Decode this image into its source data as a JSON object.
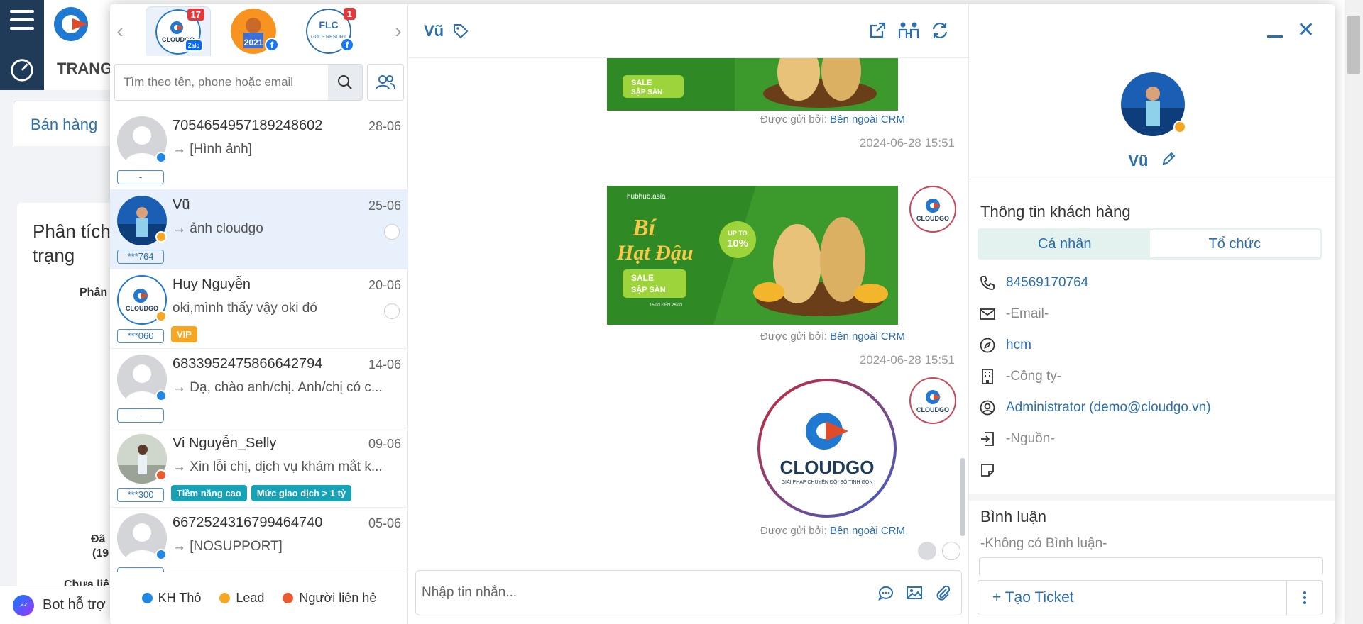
{
  "background": {
    "app_header": "TRANG",
    "tab_label": "Bán hàng",
    "card_title": "Phân tích trạng",
    "card_texts": [
      "Phân",
      "Đã",
      "(19",
      "Chưa liê"
    ],
    "bot_label": "Bot hỗ trợ"
  },
  "pages": [
    {
      "name": "CloudGO Zalo",
      "badge": "17",
      "type": "zalo"
    },
    {
      "name": "Tuyển sinh 2021",
      "badge": "",
      "type": "facebook"
    },
    {
      "name": "FLC Quy Nhon Beach Golf Resort",
      "badge": "1",
      "type": "facebook"
    }
  ],
  "search": {
    "placeholder": "Tìm theo tên, phone hoặc email"
  },
  "conversations": [
    {
      "name": "7054654957189248602",
      "date": "28-06",
      "last": "→ [Hình ảnh]",
      "phone": "-",
      "status_color": "#1e88e5",
      "avatar": "default",
      "tags": []
    },
    {
      "name": "Vũ",
      "date": "25-06",
      "last": "→ ảnh cloudgo",
      "phone": "***764",
      "status_color": "#f5a623",
      "avatar": "photo",
      "tags": [],
      "active": true
    },
    {
      "name": "Huy Nguyễn",
      "date": "20-06",
      "last": "oki,mình thấy vậy oki đó",
      "phone": "***060",
      "status_color": "#f5a623",
      "avatar": "cloudgo",
      "tags": [
        {
          "label": "VIP",
          "color": "#f5a623"
        }
      ]
    },
    {
      "name": "6833952475866642794",
      "date": "14-06",
      "last": "→ Dạ, chào anh/chị. Anh/chị có c...",
      "phone": "-",
      "status_color": "#1e88e5",
      "avatar": "default",
      "tags": []
    },
    {
      "name": "Vi Nguyễn_Selly",
      "date": "09-06",
      "last": "→ Xin lỗi chị, dịch vụ khám mắt k...",
      "phone": "***300",
      "status_color": "#ec5b30",
      "avatar": "girl",
      "tags": [
        {
          "label": "Tiềm năng cao",
          "color": "#17a2b8"
        },
        {
          "label": "Mức giao dịch > 1 tỷ",
          "color": "#17a2b8"
        }
      ]
    },
    {
      "name": "6672524316799464740",
      "date": "05-06",
      "last": "→ [NOSUPPORT]",
      "phone": "-",
      "status_color": "#1e88e5",
      "avatar": "default",
      "tags": []
    }
  ],
  "legend": [
    {
      "label": "KH Thô",
      "color": "#1e88e5"
    },
    {
      "label": "Lead",
      "color": "#f5a623"
    },
    {
      "label": "Người liên hệ",
      "color": "#ec5b30"
    }
  ],
  "chat": {
    "name": "Vũ",
    "sent_by_prefix": "Được gửi bởi:",
    "sent_by_value": "Bên ngoài CRM",
    "timestamps": [
      "2024-06-28 15:51",
      "2024-06-28 15:51"
    ],
    "banner": {
      "brand": "hubhub.asia",
      "title1": "Bí",
      "title2": "Hạt Đậu",
      "discount_top": "UP TO",
      "discount": "10%",
      "sale1": "SALE",
      "sale2": "SẬP SÀN",
      "sale_date": "15.03 ĐẾN 26.03"
    },
    "logo": {
      "brand": "CLOUDGO",
      "tagline": "GIẢI PHÁP CHUYỂN ĐỔI SỐ TINH GỌN"
    },
    "composer_placeholder": "Nhập tin nhắn..."
  },
  "profile": {
    "name": "Vũ",
    "info_title": "Thông tin khách hàng",
    "seg_personal": "Cá nhân",
    "seg_org": "Tổ chức",
    "phone": "84569170764",
    "email": "-Email-",
    "location": "hcm",
    "company": "-Công ty-",
    "owner": "Administrator (demo@cloudgo.vn)",
    "source": "-Nguồn-",
    "comments_title": "Bình luận",
    "no_comments": "-Không có Bình luận-",
    "create_ticket": "+ Tạo Ticket"
  }
}
